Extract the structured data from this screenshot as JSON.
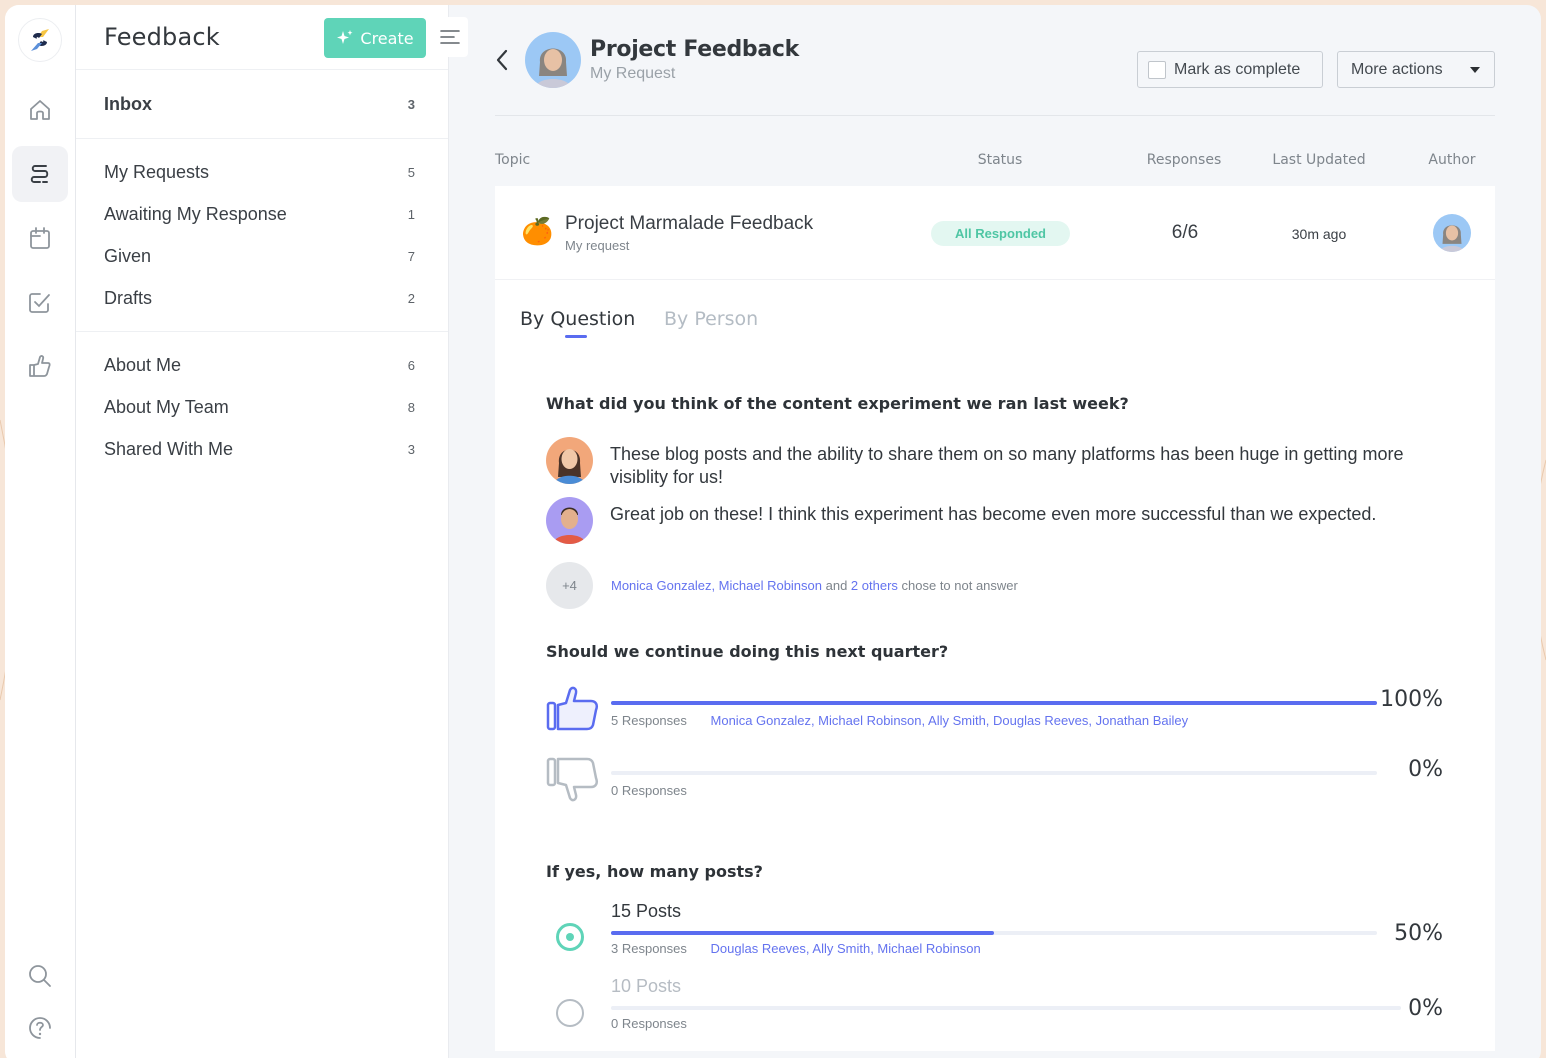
{
  "app": {
    "section_title": "Feedback",
    "create_label": "Create"
  },
  "rail": {
    "items": [
      {
        "icon": "home-icon"
      },
      {
        "icon": "feedback-icon",
        "active": true
      },
      {
        "icon": "calendar-icon"
      },
      {
        "icon": "checklist-icon"
      },
      {
        "icon": "thumbs-up-icon"
      }
    ],
    "bottom": [
      {
        "icon": "search-icon"
      },
      {
        "icon": "help-icon"
      }
    ]
  },
  "nav": {
    "inbox": {
      "label": "Inbox",
      "count": "3"
    },
    "group1": [
      {
        "label": "My Requests",
        "count": "5"
      },
      {
        "label": "Awaiting My Response",
        "count": "1"
      },
      {
        "label": "Given",
        "count": "7"
      },
      {
        "label": "Drafts",
        "count": "2"
      }
    ],
    "group2": [
      {
        "label": "About Me",
        "count": "6"
      },
      {
        "label": "About My Team",
        "count": "8"
      },
      {
        "label": "Shared With Me",
        "count": "3"
      }
    ]
  },
  "header": {
    "title": "Project Feedback",
    "subtitle": "My Request",
    "mark_complete_label": "Mark as complete",
    "more_actions_label": "More actions"
  },
  "columns": {
    "topic": "Topic",
    "status": "Status",
    "responses": "Responses",
    "last_updated": "Last Updated",
    "author": "Author"
  },
  "topic": {
    "icon": "🍊",
    "name": "Project Marmalade Feedback",
    "sub": "My request",
    "status": "All Responded",
    "responses": "6/6",
    "last_updated": "30m ago"
  },
  "tabs": {
    "active": "By Question",
    "inactive": "By Person"
  },
  "q1": {
    "title": "What did you think of the content experiment we ran last week?",
    "answers": [
      {
        "text": "These blog posts and the ability to share them on so many platforms has been huge in getting more visiblity for us!"
      },
      {
        "text": "Great job on these! I think this experiment has become even more successful than we expected."
      }
    ],
    "skipped": {
      "badge": "+4",
      "names": "Monica Gonzalez, Michael Robinson",
      "and": " and ",
      "others": "2 others",
      "suffix": " chose to not answer"
    }
  },
  "q2": {
    "title": "Should we continue doing this next quarter?",
    "options": [
      {
        "icon": "thumbs-up-icon",
        "fraction": 1.0,
        "percent": "100%",
        "responses": "5 Responses",
        "names": "Monica Gonzalez, Michael Robinson, Ally Smith, Douglas Reeves, Jonathan Bailey"
      },
      {
        "icon": "thumbs-down-icon",
        "fraction": 0.0,
        "percent": "0%",
        "responses": "0 Responses",
        "names": ""
      }
    ]
  },
  "q3": {
    "title": "If yes, how many posts?",
    "options": [
      {
        "label": "15 Posts",
        "selected": true,
        "fraction": 0.5,
        "percent": "50%",
        "responses": "3 Responses",
        "names": "Douglas Reeves, Ally Smith, Michael Robinson"
      },
      {
        "label": "10 Posts",
        "selected": false,
        "fraction": 0.0,
        "percent": "0%",
        "responses": "0 Responses",
        "names": ""
      }
    ]
  },
  "colors": {
    "accent": "#5a6cf0",
    "create": "#5fd4b8",
    "status_bg": "#e3f7f1",
    "status_text": "#4fc6a4",
    "link": "#6473ef"
  }
}
